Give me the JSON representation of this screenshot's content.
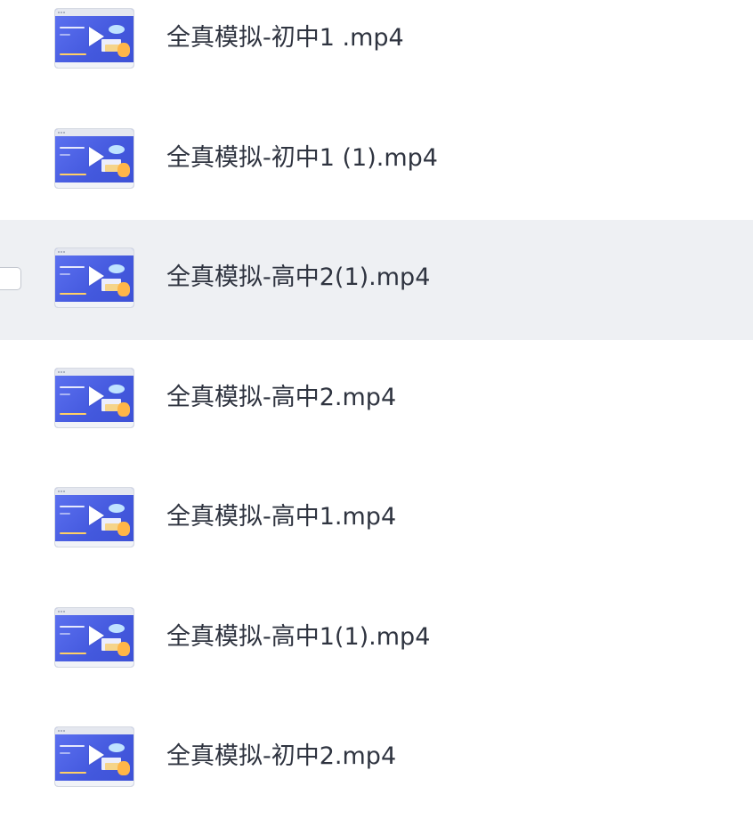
{
  "files": [
    {
      "name": "全真模拟-初中1 .mp4",
      "type": "video",
      "hovered": false
    },
    {
      "name": "全真模拟-初中1 (1).mp4",
      "type": "video",
      "hovered": false
    },
    {
      "name": "全真模拟-高中2(1).mp4",
      "type": "video",
      "hovered": true
    },
    {
      "name": "全真模拟-高中2.mp4",
      "type": "video",
      "hovered": false
    },
    {
      "name": "全真模拟-高中1.mp4",
      "type": "video",
      "hovered": false
    },
    {
      "name": "全真模拟-高中1(1).mp4",
      "type": "video",
      "hovered": false
    },
    {
      "name": "全真模拟-初中2.mp4",
      "type": "video",
      "hovered": false
    }
  ],
  "icons": {
    "thumbnail_overlay": "play-icon",
    "row_select": "checkbox"
  },
  "colors": {
    "hover_row": "#eef0f3",
    "thumbnail_blue": "#4b62e6",
    "text": "#2f3440"
  }
}
